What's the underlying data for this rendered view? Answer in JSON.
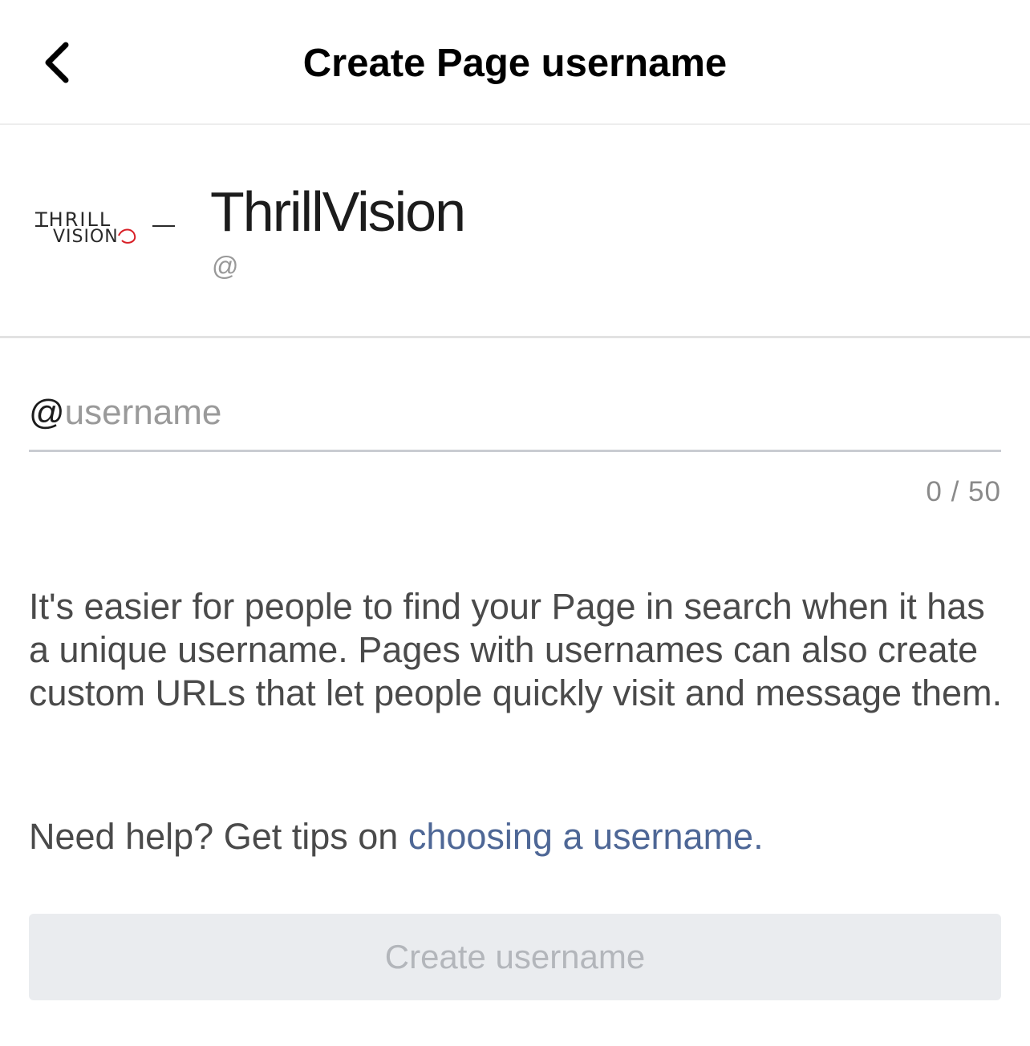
{
  "header": {
    "title": "Create Page username",
    "back_icon": "chevron-left-icon"
  },
  "profile": {
    "page_name": "ThrillVision",
    "handle_prefix": "@",
    "logo_text_top": "THRILL",
    "logo_text_bottom": "VISION",
    "logo_accent_color": "#d81f26"
  },
  "username_field": {
    "prefix": "@",
    "value": "",
    "placeholder": "username",
    "counter": "0 / 50"
  },
  "description": "It's easier for people to find your Page in search when it has a unique username. Pages with usernames can also create custom URLs that let people quickly visit and message them.",
  "help": {
    "text": "Need help? Get tips on ",
    "link_label": "choosing a username."
  },
  "create_button": {
    "label": "Create username",
    "enabled": false
  },
  "colors": {
    "link": "#4e6796",
    "button_disabled_bg": "#eaecef",
    "button_disabled_text": "#b3b6bb"
  }
}
